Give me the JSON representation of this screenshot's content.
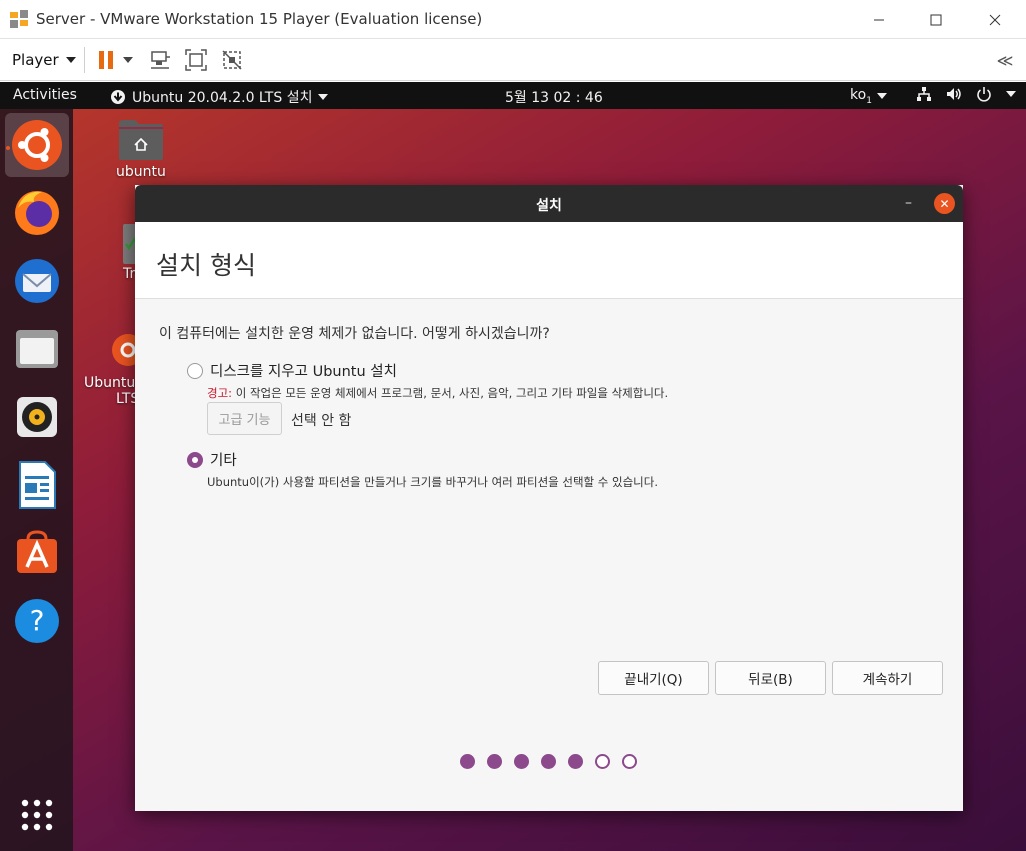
{
  "vmware": {
    "window_title": "Server - VMware Workstation 15 Player (Evaluation license)",
    "toolbar": {
      "player_menu_label": "Player"
    }
  },
  "ubuntu_panel": {
    "activities_label": "Activities",
    "app_menu_label": "Ubuntu 20.04.2.0 LTS 설치",
    "clock": "5월 13  02 : 46",
    "input_method": "ko",
    "input_method_sub": "1"
  },
  "desktop": {
    "icons": [
      {
        "label": "ubuntu"
      },
      {
        "label": "Tr"
      },
      {
        "label_line1": "Ubuntu",
        "label_line2": "LTS"
      }
    ]
  },
  "dock": {
    "items": [
      "ubuntu-installer-icon",
      "firefox-icon",
      "thunderbird-icon",
      "files-icon",
      "rhythmbox-icon",
      "libreoffice-writer-icon",
      "ubuntu-software-icon",
      "help-icon",
      "show-applications-icon"
    ]
  },
  "dialog": {
    "window_title": "설치",
    "page_title": "설치 형식",
    "question": "이 컴퓨터에는 설치한 운영 체제가 없습니다. 어떻게 하시겠습니까?",
    "options": [
      {
        "label": "디스크를 지우고 Ubuntu 설치",
        "selected": false,
        "warning_label": "경고:",
        "warning_text": " 이 작업은 모든 운영 체제에서 프로그램, 문서, 사진, 음악, 그리고 기타 파일을 삭제합니다.",
        "advanced_button": "고급 기능",
        "advanced_status": "선택 안 함"
      },
      {
        "label": "기타",
        "selected": true,
        "description": "Ubuntu이(가) 사용할 파티션을 만들거나 크기를 바꾸거나 여러 파티션을 선택할 수 있습니다."
      }
    ],
    "buttons": {
      "quit": "끝내기(Q)",
      "back": "뒤로(B)",
      "continue": "계속하기"
    },
    "progress": {
      "total": 7,
      "completed": 5
    }
  },
  "colors": {
    "accent_orange": "#e95420",
    "selection_purple": "#8c4a8c",
    "warning_red": "#c7162b"
  }
}
